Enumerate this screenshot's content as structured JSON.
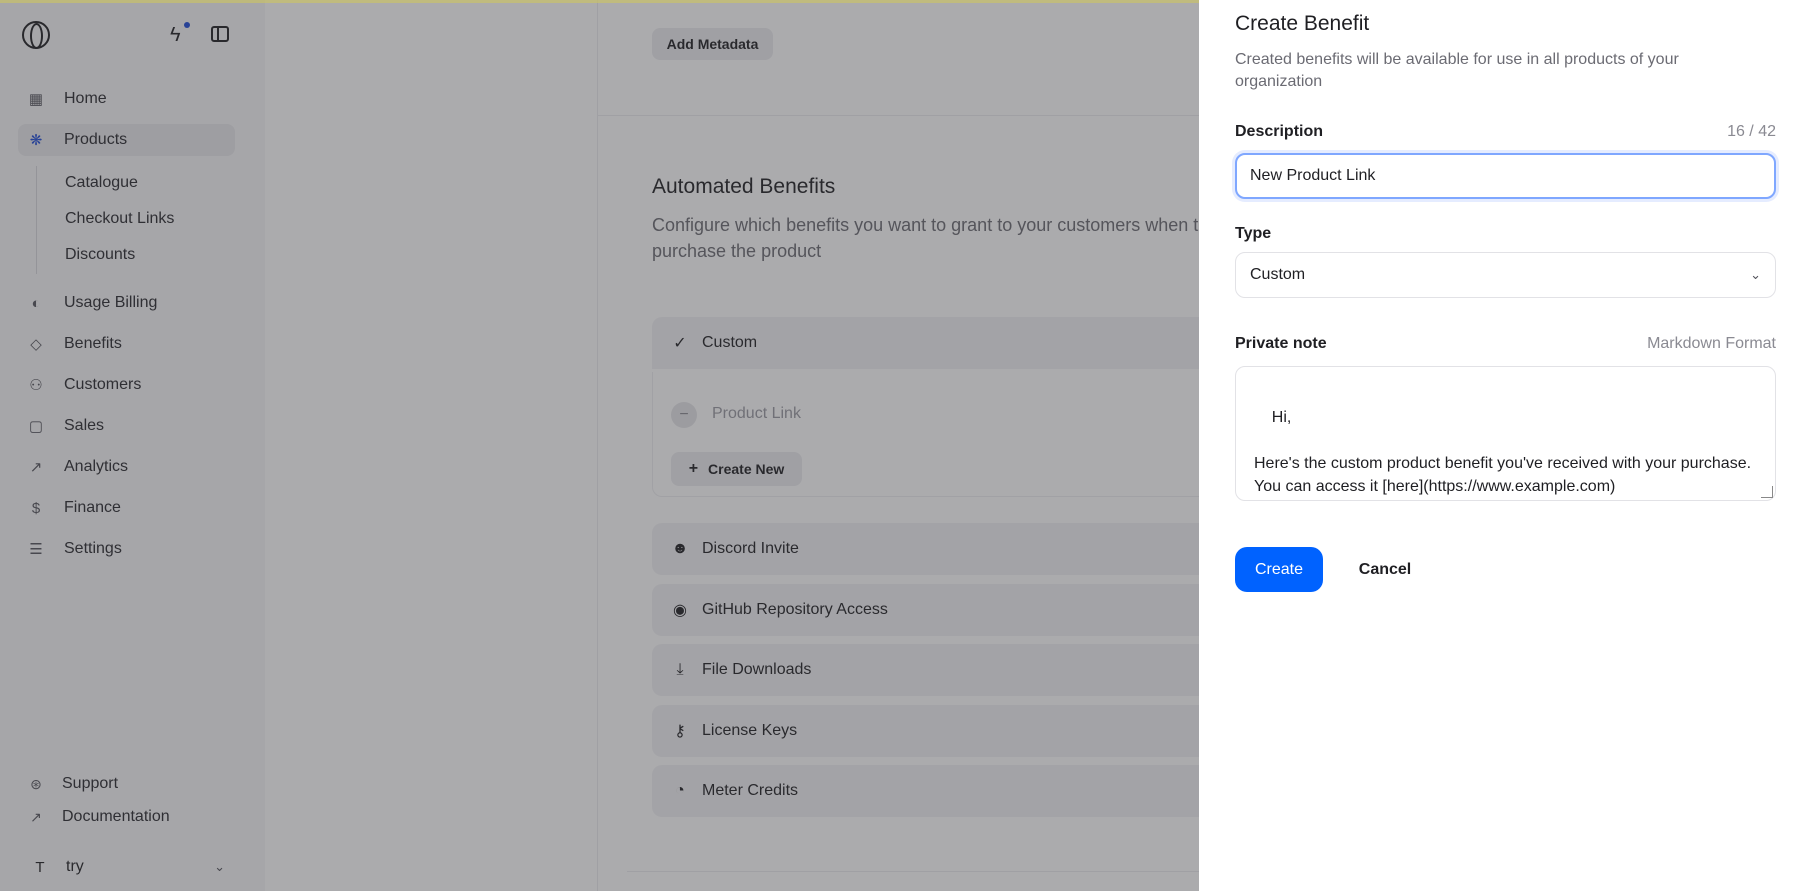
{
  "sidebar": {
    "nav": [
      {
        "label": "Home",
        "icon": "home-icon"
      },
      {
        "label": "Products",
        "icon": "products-icon"
      },
      {
        "label": "Usage Billing",
        "icon": "usage-billing-icon"
      },
      {
        "label": "Benefits",
        "icon": "diamond-icon"
      },
      {
        "label": "Customers",
        "icon": "users-icon"
      },
      {
        "label": "Sales",
        "icon": "shopping-bag-icon"
      },
      {
        "label": "Analytics",
        "icon": "trend-icon"
      },
      {
        "label": "Finance",
        "icon": "dollar-icon"
      },
      {
        "label": "Settings",
        "icon": "sliders-icon"
      }
    ],
    "sub_items": [
      "Catalogue",
      "Checkout Links",
      "Discounts"
    ],
    "bottom": [
      {
        "label": "Support",
        "icon": "support-icon"
      },
      {
        "label": "Documentation",
        "icon": "arrow-up-right-icon"
      }
    ],
    "user": {
      "initial": "T",
      "name": "try"
    }
  },
  "main": {
    "metadata_button": "Add Metadata",
    "section_title": "Automated Benefits",
    "section_desc": "Configure which benefits you want to grant to your customers when they purchase the product",
    "selected_benefit": "Custom",
    "sub_benefit": "Product Link",
    "create_new": "Create New",
    "benefit_types": [
      {
        "label": "Discord Invite",
        "icon": "discord-icon"
      },
      {
        "label": "GitHub Repository Access",
        "icon": "github-icon"
      },
      {
        "label": "File Downloads",
        "icon": "download-icon"
      },
      {
        "label": "License Keys",
        "icon": "key-icon"
      },
      {
        "label": "Meter Credits",
        "icon": "gauge-icon"
      }
    ]
  },
  "drawer": {
    "title": "Create Benefit",
    "subtitle": "Created benefits will be available for use in all products of your organization",
    "description_label": "Description",
    "description_counter": "16 / 42",
    "description_value": "New Product Link",
    "type_label": "Type",
    "type_value": "Custom",
    "note_label": "Private note",
    "note_hint": "Markdown Format",
    "note_value": "Hi,\n\nHere's the custom product benefit you've received with your purchase. You can access it [here](https://www.example.com)",
    "create_button": "Create",
    "cancel_button": "Cancel"
  },
  "colors": {
    "accent": "#0062ff",
    "active_nav_icon": "#1e4bd8",
    "overlay": "rgba(55,55,60,0.42)"
  }
}
